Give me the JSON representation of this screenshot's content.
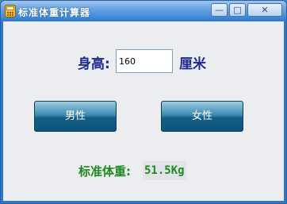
{
  "window": {
    "title": "标准体重计算器",
    "icon": "calculator-app-icon",
    "controls": {
      "minimize": "—",
      "maximize": "□",
      "close": "✕"
    }
  },
  "form": {
    "height_label": "身高:",
    "height_value": "160",
    "unit_label": "厘米"
  },
  "buttons": {
    "male": "男性",
    "female": "女性"
  },
  "result": {
    "label": "标准体重:",
    "value": "51.5Kg"
  }
}
